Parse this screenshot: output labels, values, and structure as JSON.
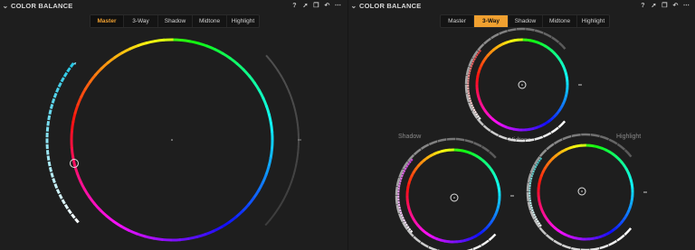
{
  "left_panel": {
    "title": "COLOR BALANCE",
    "tabs": [
      "Master",
      "3-Way",
      "Shadow",
      "Midtone",
      "Highlight"
    ],
    "active_tab": "Master"
  },
  "right_panel": {
    "title": "COLOR BALANCE",
    "tabs": [
      "Master",
      "3-Way",
      "Shadow",
      "Midtone",
      "Highlight"
    ],
    "active_tab": "3-Way",
    "wheel_labels": {
      "shadow": "Shadow",
      "midtone": "Midtone",
      "highlight": "Highlight"
    }
  },
  "toolbar_icons": [
    "help-icon",
    "pin-icon",
    "copy-icon",
    "reset-icon",
    "more-icon"
  ],
  "colors": {
    "accent": "#f0a030",
    "background": "#1e1e1e",
    "tab_background": "#141414"
  }
}
